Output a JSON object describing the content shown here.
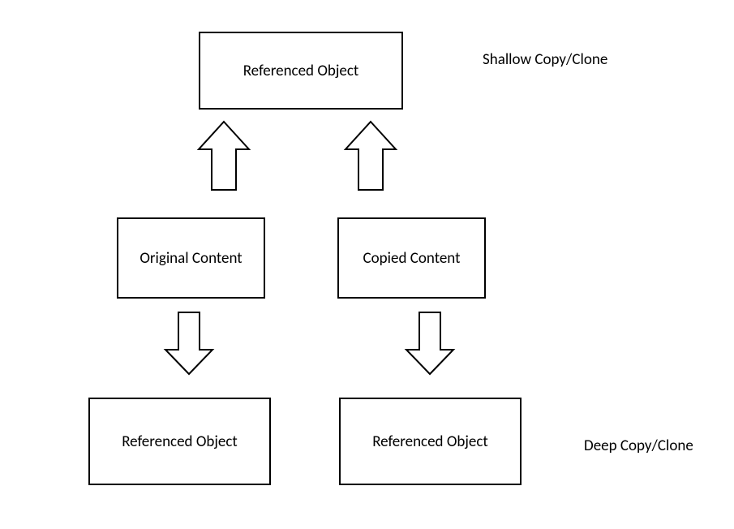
{
  "boxes": {
    "topReferenced": "Referenced Object",
    "originalContent": "Original Content",
    "copiedContent": "Copied Content",
    "bottomLeftReferenced": "Referenced Object",
    "bottomRightReferenced": "Referenced Object"
  },
  "labels": {
    "shallow": "Shallow Copy/Clone",
    "deep": "Deep Copy/Clone"
  }
}
